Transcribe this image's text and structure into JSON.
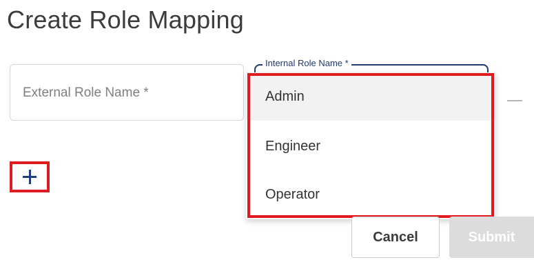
{
  "page": {
    "title": "Create Role Mapping"
  },
  "form": {
    "external_role_placeholder": "External Role Name *",
    "internal_role_label": "Internal Role Name *",
    "remove_icon": "minus-icon",
    "add_icon": "plus-icon"
  },
  "dropdown": {
    "options": [
      {
        "label": "Admin",
        "highlighted": true
      },
      {
        "label": "Engineer",
        "highlighted": false
      },
      {
        "label": "Operator",
        "highlighted": false
      }
    ]
  },
  "actions": {
    "cancel_label": "Cancel",
    "submit_label": "Submit"
  },
  "colors": {
    "accent": "#1f3a6b",
    "annotation_red": "#e11a1f",
    "disabled_button": "#dcdcdc"
  }
}
